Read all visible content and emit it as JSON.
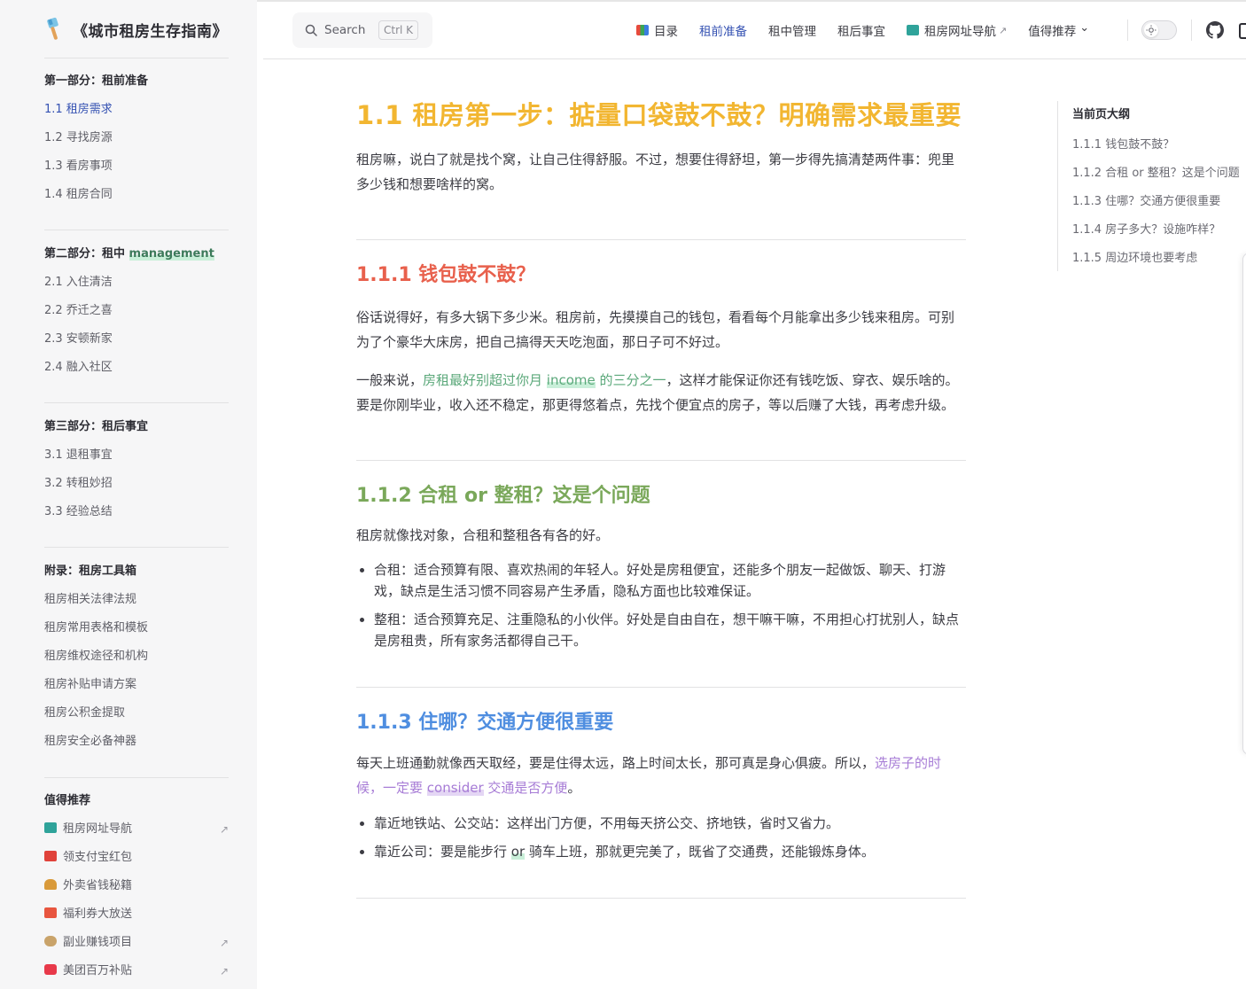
{
  "brand": {
    "title": "《城市租房生存指南》"
  },
  "sidebar": {
    "groups": [
      {
        "heading": "第一部分：租前准备",
        "items": [
          "1.1 租房需求",
          "1.2 寻找房源",
          "1.3 看房事项",
          "1.4 租房合同"
        ]
      },
      {
        "heading_prefix": "第二部分：租中 ",
        "heading_highlight": "management",
        "items": [
          "2.1 入住清洁",
          "2.2 乔迁之喜",
          "2.3 安顿新家",
          "2.4 融入社区"
        ]
      },
      {
        "heading": "第三部分：租后事宜",
        "items": [
          "3.1 退租事宜",
          "3.2 转租妙招",
          "3.3 经验总结"
        ]
      },
      {
        "heading": "附录：租房工具箱",
        "items": [
          "租房相关法律法规",
          "租房常用表格和模板",
          "租房维权途径和机构",
          "租房补贴申请方案",
          "租房公积金提取",
          "租房安全必备神器"
        ]
      },
      {
        "heading": "值得推荐",
        "items": [
          "租房网址导航",
          "领支付宝红包",
          "外卖省钱秘籍",
          "福利券大放送",
          "副业赚钱项目",
          "美团百万补贴"
        ]
      }
    ],
    "ext_arrow": "↗"
  },
  "search": {
    "label": "Search",
    "shortcut": "Ctrl K"
  },
  "nav": {
    "items": [
      "目录",
      "租前准备",
      "租中管理",
      "租后事宜",
      "租房网址导航",
      "值得推荐"
    ],
    "ext_arrow": "↗",
    "dropdown_arrow": "⌄"
  },
  "article": {
    "title": "1.1 租房第一步：掂量口袋鼓不鼓？明确需求最重要",
    "intro": "租房嘛，说白了就是找个窝，让自己住得舒服。不过，想要住得舒坦，第一步得先搞清楚两件事：兜里多少钱和想要啥样的窝。",
    "s1": {
      "heading": "1.1.1 钱包鼓不鼓？",
      "p1": "俗话说得好，有多大锅下多少米。租房前，先摸摸自己的钱包，看看每个月能拿出多少钱来租房。可别为了个豪华大床房，把自己搞得天天吃泡面，那日子可不好过。",
      "p2_a": "一般来说，",
      "p2_g1": "房租最好别超过你月 ",
      "p2_g_hl": "income",
      "p2_g2": " 的三分之一",
      "p2_b": "，这样才能保证你还有钱吃饭、穿衣、娱乐啥的。要是你刚毕业，收入还不稳定，那更得悠着点，先找个便宜点的房子，等以后赚了大钱，再考虑升级。"
    },
    "s2": {
      "heading": "1.1.2 合租 or 整租？这是个问题",
      "p1": "租房就像找对象，合租和整租各有各的好。",
      "li1": "合租：适合预算有限、喜欢热闹的年轻人。好处是房租便宜，还能多个朋友一起做饭、聊天、打游戏，缺点是生活习惯不同容易产生矛盾，隐私方面也比较难保证。",
      "li2": "整租：适合预算充足、注重隐私的小伙伴。好处是自由自在，想干嘛干嘛，不用担心打扰别人，缺点是房租贵，所有家务活都得自己干。"
    },
    "s3": {
      "heading": "1.1.3 住哪？交通方便很重要",
      "p1_a": "每天上班通勤就像西天取经，要是住得太远，路上时间太长，那可真是身心俱疲。所以，",
      "p1_p1": "选房子的时候，一定要 ",
      "p1_p_hl": "consider",
      "p1_p2": " 交通是否方便",
      "p1_b": "。",
      "li1": "靠近地铁站、公交站：这样出门方便，不用每天挤公交、挤地铁，省时又省力。",
      "li2_a": "靠近公司：要是能步行 ",
      "li2_hl": "or",
      "li2_b": " 骑车上班，那就更完美了，既省了交通费，还能锻炼身体。"
    }
  },
  "outline": {
    "heading": "当前页大纲",
    "items": [
      "1.1.1 钱包鼓不鼓？",
      "1.1.2 合租 or 整租？这是个问题",
      "1.1.3 住哪？交通方便很重要",
      "1.1.4 房子多大？设施咋样？",
      "1.1.5 周边环境也要考虑"
    ]
  }
}
